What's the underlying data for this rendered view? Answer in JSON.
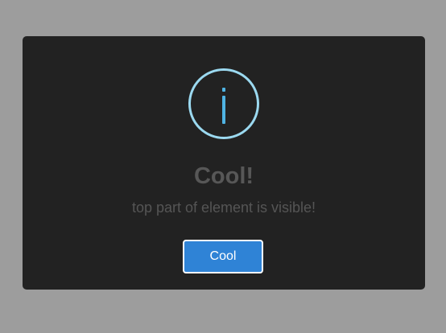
{
  "modal": {
    "icon": "info-icon",
    "title": "Cool!",
    "message": "top part of element is visible!",
    "confirm_label": "Cool"
  },
  "colors": {
    "backdrop": "#9d9d9d",
    "modal_background": "#222222",
    "icon_ring": "#9bd9f0",
    "icon_glyph": "#4fb3e3",
    "title_text": "#575757",
    "message_text": "#555555",
    "button_background": "#2f83d6",
    "button_border": "#ffffff",
    "button_text": "#ffffff"
  }
}
